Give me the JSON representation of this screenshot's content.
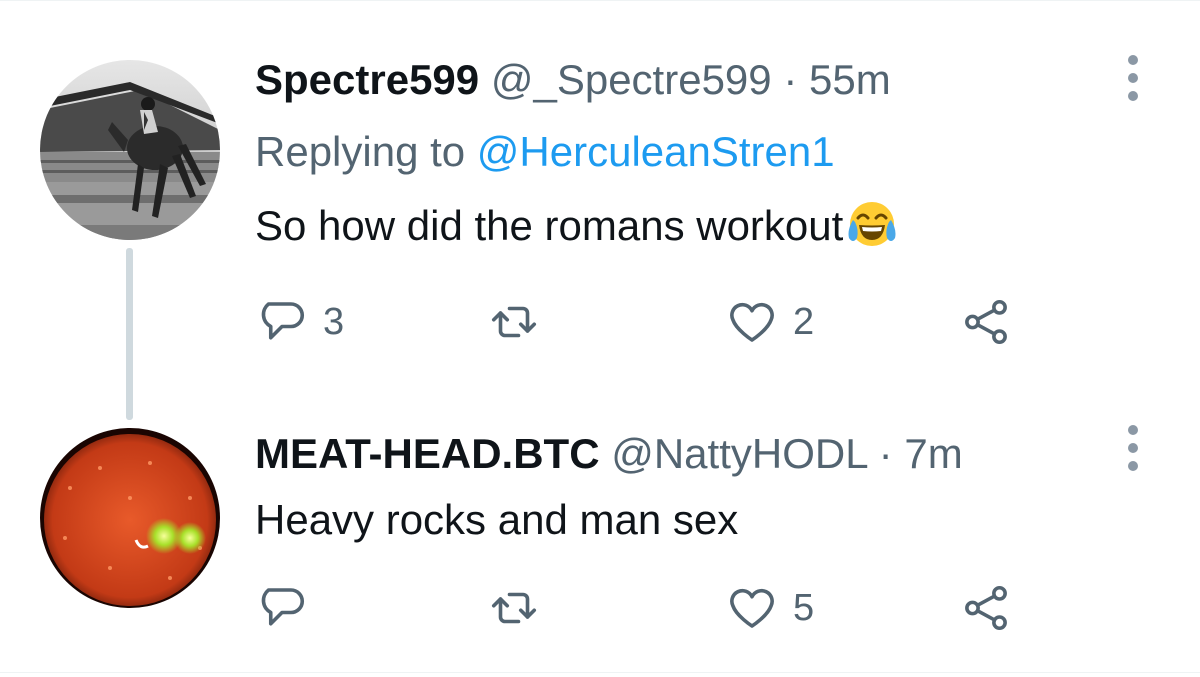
{
  "tweets": [
    {
      "display_name": "Spectre599",
      "handle": "@_Spectre599",
      "separator": "·",
      "time": "55m",
      "replying_prefix": "Replying to",
      "replying_to": "@HerculeanStren1",
      "text": "So how did the romans workout",
      "emoji": "face-with-tears-of-joy",
      "replies": "3",
      "retweets": "",
      "likes": "2"
    },
    {
      "display_name": "MEAT-HEAD.BTC",
      "handle": "@NattyHODL",
      "separator": "·",
      "time": "7m",
      "text": "Heavy rocks and man sex",
      "replies": "",
      "retweets": "",
      "likes": "5"
    }
  ],
  "colors": {
    "text": "#0f1419",
    "secondary": "#536471",
    "link": "#1d9bf0",
    "thread_line": "#cfd9de"
  },
  "icons": {
    "reply": "reply-icon",
    "retweet": "retweet-icon",
    "like": "heart-icon",
    "share": "share-icon",
    "more": "more-options-icon"
  }
}
